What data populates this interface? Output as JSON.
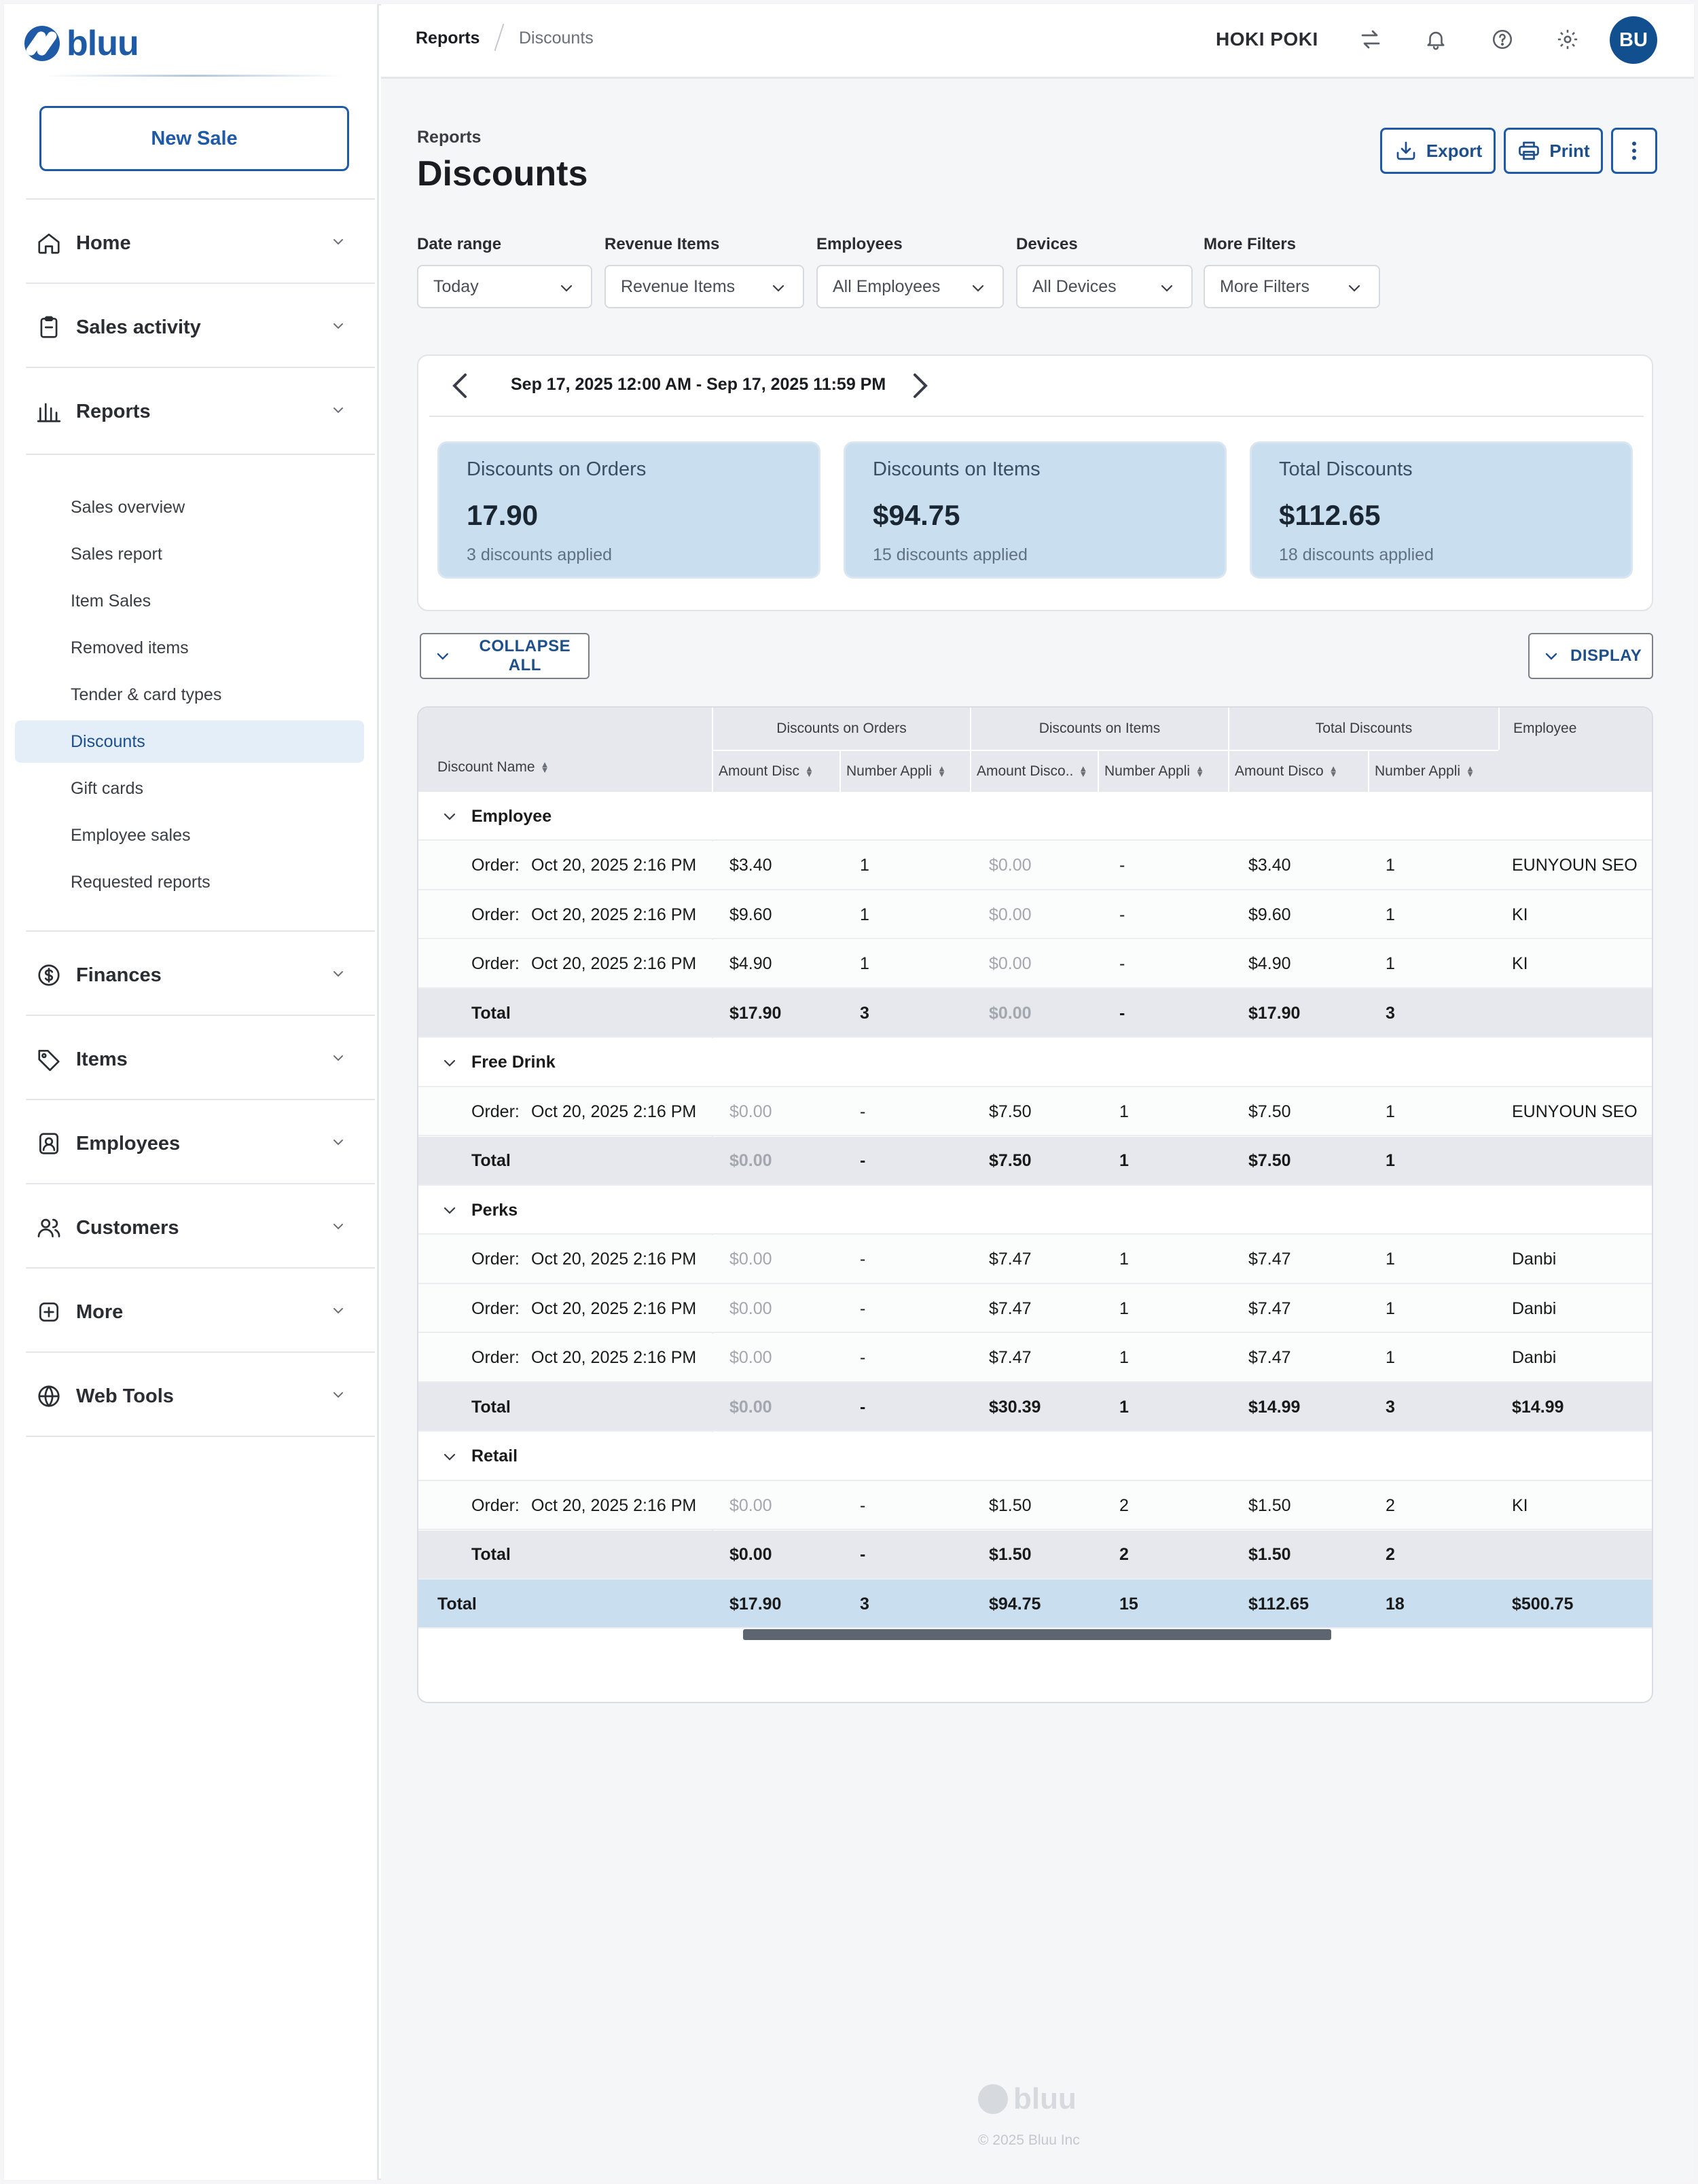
{
  "brand": {
    "name": "bluu"
  },
  "sidebar": {
    "new_sale": "New Sale",
    "nav": [
      {
        "label": "Home",
        "icon": "home-icon"
      },
      {
        "label": "Sales activity",
        "icon": "clipboard-icon"
      },
      {
        "label": "Reports",
        "icon": "bar-chart-icon"
      },
      {
        "label": "Finances",
        "icon": "dollar-circle-icon"
      },
      {
        "label": "Items",
        "icon": "tag-icon"
      },
      {
        "label": "Employees",
        "icon": "employee-badge-icon"
      },
      {
        "label": "Customers",
        "icon": "users-icon"
      },
      {
        "label": "More",
        "icon": "plus-square-icon"
      },
      {
        "label": "Web Tools",
        "icon": "globe-icon"
      }
    ],
    "report_items": [
      "Sales overview",
      "Sales report",
      "Item Sales",
      "Removed items",
      "Tender & card types",
      "Discounts",
      "Gift cards",
      "Employee sales",
      "Requested reports"
    ],
    "active_report": "Discounts"
  },
  "header": {
    "breadcrumb": [
      "Reports",
      "Discounts"
    ],
    "store_name": "HOKI POKI",
    "avatar_initials": "BU",
    "icons": [
      "swap-icon",
      "bell-icon",
      "help-icon",
      "gear-icon"
    ]
  },
  "page": {
    "kicker": "Reports",
    "title": "Discounts",
    "actions": {
      "export": "Export",
      "print": "Print"
    }
  },
  "filters": [
    {
      "label": "Date range",
      "value": "Today"
    },
    {
      "label": "Revenue Items",
      "value": "Revenue Items"
    },
    {
      "label": "Employees",
      "value": "All Employees"
    },
    {
      "label": "Devices",
      "value": "All Devices"
    },
    {
      "label": "More Filters",
      "value": "More Filters"
    }
  ],
  "summary": {
    "date_range": "Sep 17, 2025 12:00 AM - Sep 17, 2025 11:59 PM",
    "cards": [
      {
        "title": "Discounts on Orders",
        "value": "17.90",
        "sub": "3 discounts applied"
      },
      {
        "title": "Discounts on Items",
        "value": "$94.75",
        "sub": "15 discounts applied"
      },
      {
        "title": "Total Discounts",
        "value": "$112.65",
        "sub": "18 discounts applied"
      }
    ]
  },
  "table_controls": {
    "collapse": "COLLAPSE ALL",
    "display": "DISPLAY"
  },
  "table": {
    "name_header": "Discount Name",
    "groups": [
      "Discounts on Orders",
      "Discounts on Items",
      "Total Discounts",
      "Employee"
    ],
    "subheaders": [
      "Amount Disc",
      "Number Appli",
      "Amount Disco..",
      "Number Appli",
      "Amount Disco",
      "Number Appli"
    ],
    "rows": [
      {
        "type": "group",
        "name": "Employee"
      },
      {
        "type": "detail",
        "order_label": "Order:",
        "name": "Oct 20, 2025 2:16 PM",
        "cells": [
          "$3.40",
          "1",
          "$0.00",
          "-",
          "$3.40",
          "1",
          "EUNYOUN SEO"
        ],
        "muted": [
          2
        ]
      },
      {
        "type": "detail",
        "order_label": "Order:",
        "name": "Oct 20, 2025 2:16 PM",
        "cells": [
          "$9.60",
          "1",
          "$0.00",
          "-",
          "$9.60",
          "1",
          "KI"
        ],
        "muted": [
          2
        ]
      },
      {
        "type": "detail",
        "order_label": "Order:",
        "name": "Oct 20, 2025 2:16 PM",
        "cells": [
          "$4.90",
          "1",
          "$0.00",
          "-",
          "$4.90",
          "1",
          "KI"
        ],
        "muted": [
          2
        ]
      },
      {
        "type": "total",
        "name": "Total",
        "cells": [
          "$17.90",
          "3",
          "$0.00",
          "-",
          "$17.90",
          "3",
          ""
        ],
        "muted": [
          2
        ]
      },
      {
        "type": "group",
        "name": "Free Drink"
      },
      {
        "type": "detail",
        "order_label": "Order:",
        "name": "Oct 20, 2025 2:16 PM",
        "cells": [
          "$0.00",
          "-",
          "$7.50",
          "1",
          "$7.50",
          "1",
          "EUNYOUN SEO"
        ],
        "muted": [
          0
        ]
      },
      {
        "type": "total",
        "name": "Total",
        "cells": [
          "$0.00",
          "-",
          "$7.50",
          "1",
          "$7.50",
          "1",
          ""
        ],
        "muted": [
          0
        ]
      },
      {
        "type": "group",
        "name": "Perks"
      },
      {
        "type": "detail",
        "order_label": "Order:",
        "name": "Oct 20, 2025 2:16 PM",
        "cells": [
          "$0.00",
          "-",
          "$7.47",
          "1",
          "$7.47",
          "1",
          "Danbi"
        ],
        "muted": [
          0
        ]
      },
      {
        "type": "detail",
        "order_label": "Order:",
        "name": "Oct 20, 2025 2:16 PM",
        "cells": [
          "$0.00",
          "-",
          "$7.47",
          "1",
          "$7.47",
          "1",
          "Danbi"
        ],
        "muted": [
          0
        ]
      },
      {
        "type": "detail",
        "order_label": "Order:",
        "name": "Oct 20, 2025 2:16 PM",
        "cells": [
          "$0.00",
          "-",
          "$7.47",
          "1",
          "$7.47",
          "1",
          "Danbi"
        ],
        "muted": [
          0
        ]
      },
      {
        "type": "total",
        "name": "Total",
        "cells": [
          "$0.00",
          "-",
          "$30.39",
          "1",
          "$14.99",
          "3",
          "$14.99"
        ],
        "muted": [
          0
        ]
      },
      {
        "type": "group",
        "name": "Retail"
      },
      {
        "type": "detail",
        "order_label": "Order:",
        "name": "Oct 20, 2025 2:16 PM",
        "cells": [
          "$0.00",
          "-",
          "$1.50",
          "2",
          "$1.50",
          "2",
          "KI"
        ],
        "muted": [
          0
        ]
      },
      {
        "type": "total",
        "name": "Total",
        "cells": [
          "$0.00",
          "-",
          "$1.50",
          "2",
          "$1.50",
          "2",
          ""
        ],
        "muted": []
      },
      {
        "type": "grand",
        "name": "Total",
        "cells": [
          "$17.90",
          "3",
          "$94.75",
          "15",
          "$112.65",
          "18",
          "$500.75"
        ],
        "muted": []
      }
    ]
  },
  "footer": {
    "copyright": "© 2025 Bluu Inc"
  }
}
